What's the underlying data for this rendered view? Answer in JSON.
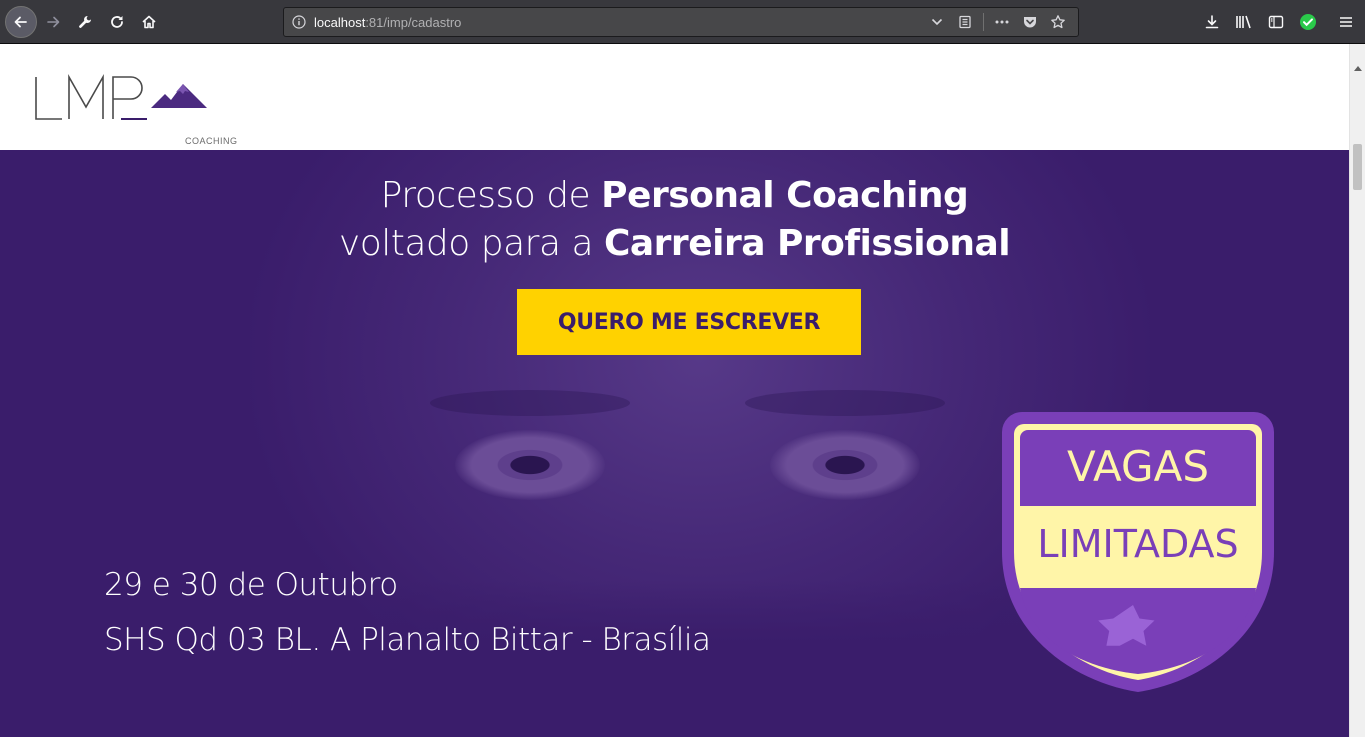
{
  "browser": {
    "url_host": "localhost",
    "url_path": ":81/imp/cadastro"
  },
  "header": {
    "logo_letters": "LMP",
    "logo_tagline": "COACHING"
  },
  "hero": {
    "line1_light": "Processo de ",
    "line1_bold": "Personal Coaching",
    "line2_light": "voltado para a ",
    "line2_bold": "Carreira Profissional",
    "cta_label": "QUERO ME ESCREVER",
    "event_date": "29 e 30 de Outubro",
    "event_place": "SHS Qd 03 BL. A Planalto Bittar - Brasília",
    "badge_line1": "VAGAS",
    "badge_line2": "LIMITADAS"
  },
  "colors": {
    "hero_bg": "#3a1d6b",
    "cta_bg": "#ffd200",
    "badge_purple": "#7a3fb8",
    "badge_cream": "#fff5a8"
  }
}
